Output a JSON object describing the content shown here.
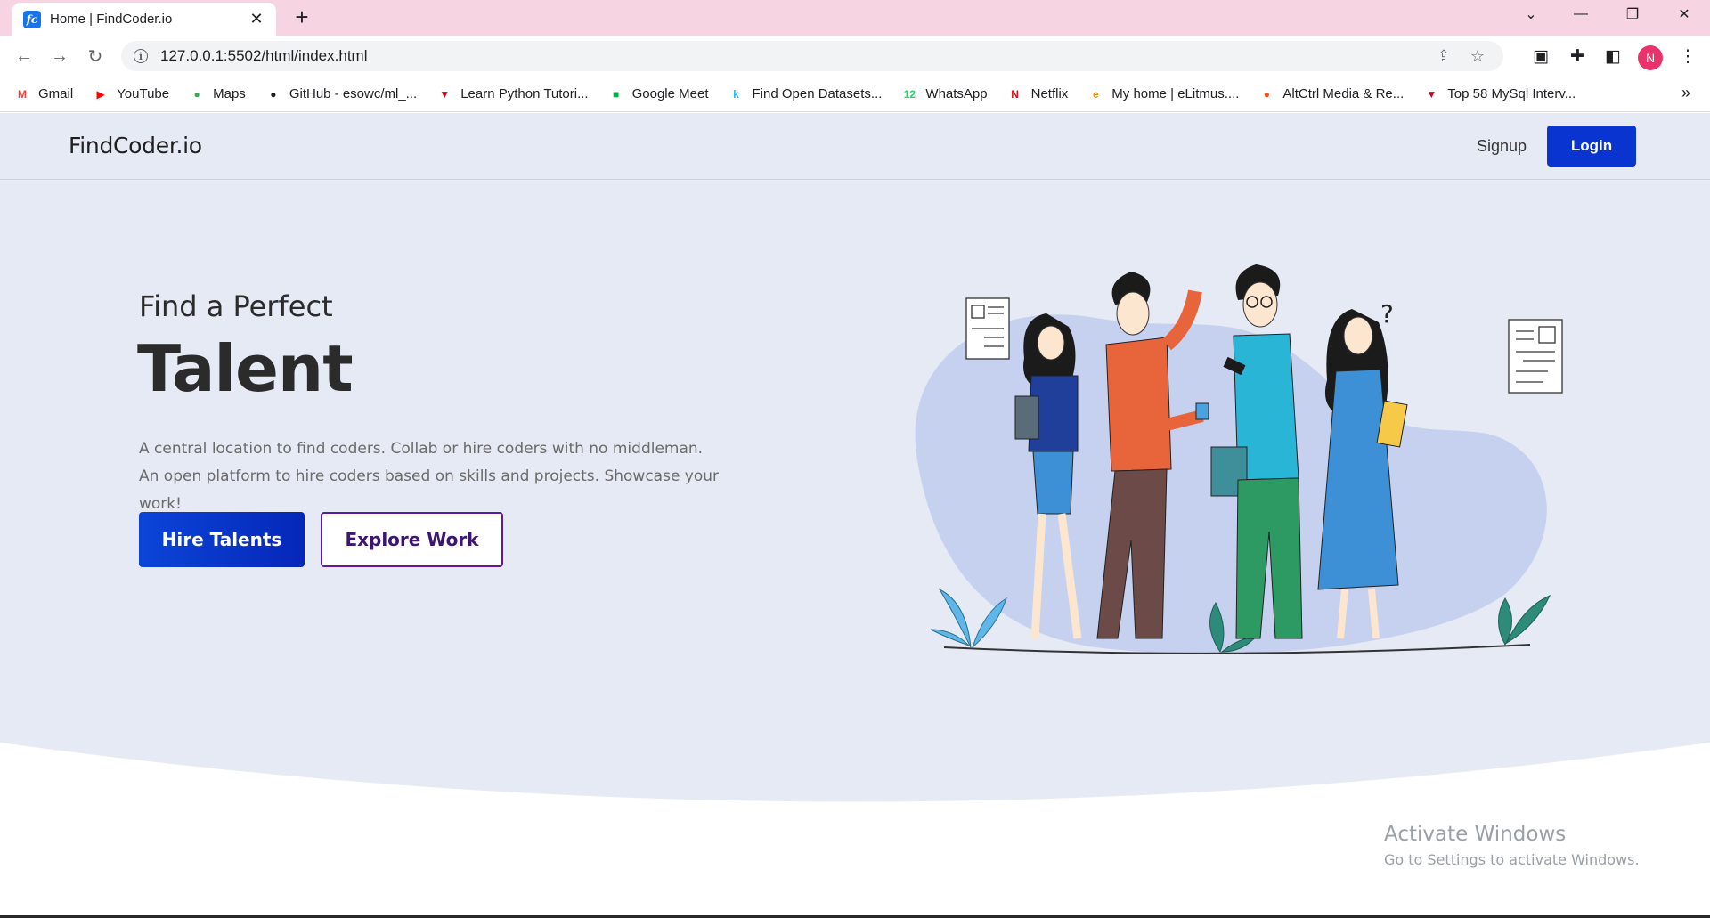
{
  "browser": {
    "tab": {
      "favicon_text": "fc",
      "title": "Home | FindCoder.io"
    },
    "url": "127.0.0.1:5502/html/index.html",
    "profile_initial": "N",
    "bookmarks": [
      {
        "label": "Gmail",
        "icon": "gmail-icon",
        "glyph": "M",
        "color": "#ea4335"
      },
      {
        "label": "YouTube",
        "icon": "youtube-icon",
        "glyph": "▶",
        "color": "#ff0000"
      },
      {
        "label": "Maps",
        "icon": "maps-icon",
        "glyph": "●",
        "color": "#34a853"
      },
      {
        "label": "GitHub - esowc/ml_...",
        "icon": "github-icon",
        "glyph": "●",
        "color": "#202124"
      },
      {
        "label": "Learn Python Tutori...",
        "icon": "learn-python-icon",
        "glyph": "▼",
        "color": "#d0021b"
      },
      {
        "label": "Google Meet",
        "icon": "google-meet-icon",
        "glyph": "■",
        "color": "#00ac47"
      },
      {
        "label": "Find Open Datasets...",
        "icon": "kaggle-icon",
        "glyph": "k",
        "color": "#20beff"
      },
      {
        "label": "WhatsApp",
        "icon": "whatsapp-icon",
        "glyph": "12",
        "color": "#25d366"
      },
      {
        "label": "Netflix",
        "icon": "netflix-icon",
        "glyph": "N",
        "color": "#e50914"
      },
      {
        "label": "My home | eLitmus....",
        "icon": "elitmus-icon",
        "glyph": "e",
        "color": "#f28b1b"
      },
      {
        "label": "AltCtrl Media & Re...",
        "icon": "altctrl-icon",
        "glyph": "●",
        "color": "#f4511e"
      },
      {
        "label": "Top 58 MySql Interv...",
        "icon": "mysql-icon",
        "glyph": "▼",
        "color": "#d0021b"
      }
    ],
    "bookmarks_more": "»"
  },
  "site": {
    "brand": "FindCoder.io",
    "nav": {
      "signup": "Signup",
      "login": "Login"
    },
    "hero": {
      "subtitle": "Find a Perfect",
      "title": "Talent",
      "description": "A central location to find coders. Collab or hire coders with no middleman. An open platform to hire coders based on skills and projects. Showcase your work!",
      "primary_cta": "Hire Talents",
      "secondary_cta": "Explore Work"
    },
    "colors": {
      "hero_bg": "#e6eaf5",
      "accent": "#0a34d0",
      "outline": "#5b1aa0"
    }
  },
  "watermark": {
    "line1": "Activate Windows",
    "line2": "Go to Settings to activate Windows."
  }
}
